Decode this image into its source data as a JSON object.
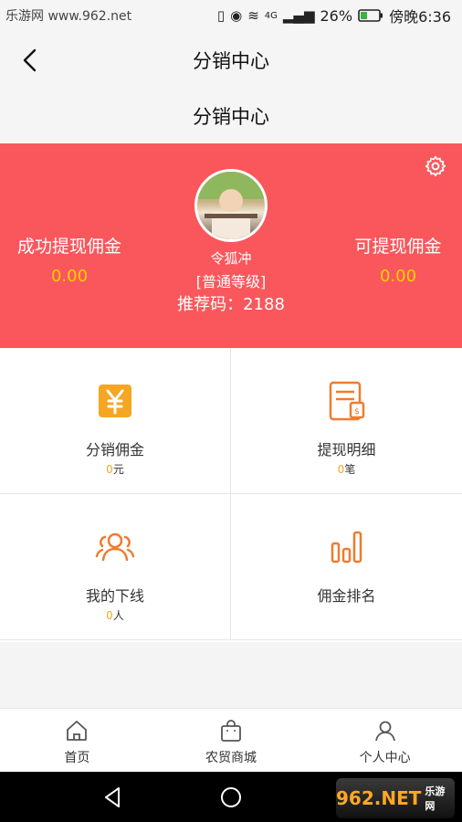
{
  "status_bar": {
    "watermark_text": "乐游网 www.962.net",
    "battery": "26%",
    "time": "傍晚6:36",
    "network": "4G"
  },
  "nav": {
    "title": "分销中心"
  },
  "sub_header": {
    "title": "分销中心"
  },
  "profile": {
    "success_label": "成功提现佣金",
    "success_value": "0.00",
    "available_label": "可提现佣金",
    "available_value": "0.00",
    "nickname": "令狐冲",
    "level": "[普通等级]",
    "ref_code": "推荐码：2188"
  },
  "grid": {
    "items": [
      {
        "label": "分销佣金",
        "num": "0",
        "unit": "元",
        "icon": "yen-icon"
      },
      {
        "label": "提现明细",
        "num": "0",
        "unit": "笔",
        "icon": "bill-icon"
      },
      {
        "label": "我的下线",
        "num": "0",
        "unit": "人",
        "icon": "group-icon"
      },
      {
        "label": "佣金排名",
        "icon": "bar-chart-icon"
      }
    ]
  },
  "tabbar": {
    "items": [
      {
        "label": "首页",
        "icon": "home-icon"
      },
      {
        "label": "农贸商城",
        "icon": "shopping-bag-icon"
      },
      {
        "label": "个人中心",
        "icon": "user-icon"
      }
    ]
  },
  "watermark": {
    "text": "962.NET",
    "sub": "乐游网"
  },
  "colors": {
    "banner": "#f9575c",
    "accent": "#f5a623",
    "value": "#ffd200",
    "icon_orange": "#f07b2e"
  }
}
